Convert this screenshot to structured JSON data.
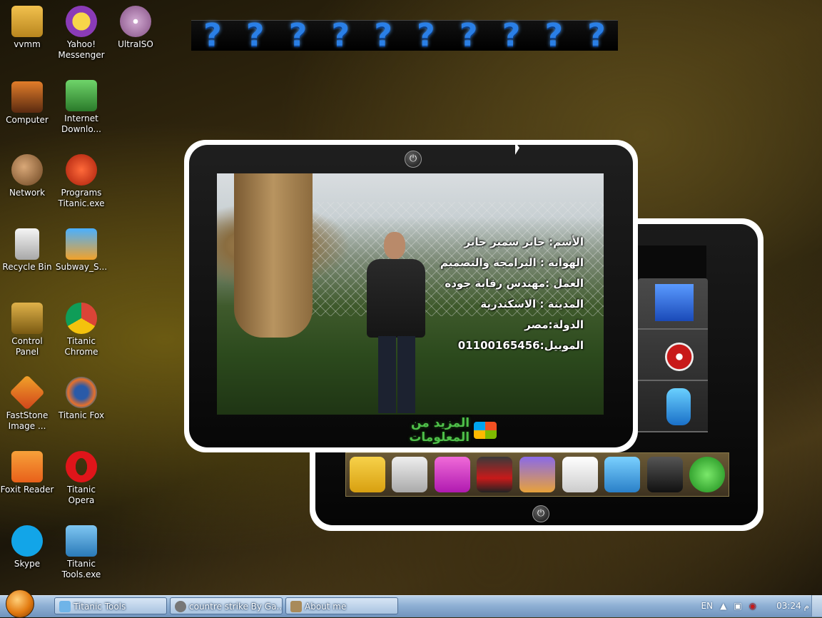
{
  "desktop_icons": [
    {
      "label": "vvmm",
      "icon": "folder-icon"
    },
    {
      "label": "Yahoo! Messenger",
      "icon": "yahoo-messenger-icon"
    },
    {
      "label": "UltraISO",
      "icon": "ultraiso-icon"
    },
    {
      "label": "Computer",
      "icon": "computer-icon"
    },
    {
      "label": "Internet Downlo...",
      "icon": "download-manager-icon"
    },
    {
      "label": "Network",
      "icon": "network-icon"
    },
    {
      "label": "Programs Titanic.exe",
      "icon": "programs-icon"
    },
    {
      "label": "Recycle Bin",
      "icon": "recycle-bin-icon"
    },
    {
      "label": "Subway_S...",
      "icon": "subway-surfers-icon"
    },
    {
      "label": "Control Panel",
      "icon": "control-panel-icon"
    },
    {
      "label": "Titanic Chrome",
      "icon": "chrome-icon"
    },
    {
      "label": "FastStone Image ...",
      "icon": "faststone-icon"
    },
    {
      "label": "Titanic Fox",
      "icon": "firefox-icon"
    },
    {
      "label": "Foxit Reader",
      "icon": "foxit-reader-icon"
    },
    {
      "label": "Titanic Opera",
      "icon": "opera-icon"
    },
    {
      "label": "Skype",
      "icon": "skype-icon"
    },
    {
      "label": "Titanic Tools.exe",
      "icon": "tools-icon"
    }
  ],
  "question_marks": [
    "?",
    "?",
    "?",
    "?",
    "?",
    "?",
    "?",
    "?",
    "?",
    "?"
  ],
  "profile": {
    "name": "الأسم: جابر سمير جابر",
    "hobby": "الهواية : البرامجة والتصميم",
    "work": "العمل :مهندس رقابة جوده",
    "city": "المدينة : الاسكندرية",
    "country": "الدولة:مصر",
    "mobile": "الموبيل:01100165456"
  },
  "more_info_label": "المزيد من المعلومات",
  "taskbar": {
    "tasks": [
      "Titanic Tools",
      "countre strike By Ga...",
      "About me"
    ],
    "language": "EN",
    "time": "03:24",
    "ampm": "م"
  },
  "colors": {
    "accent": "#2a7fe6",
    "link_green": "#4fc04a",
    "taskbar": "#8fb0d4"
  }
}
